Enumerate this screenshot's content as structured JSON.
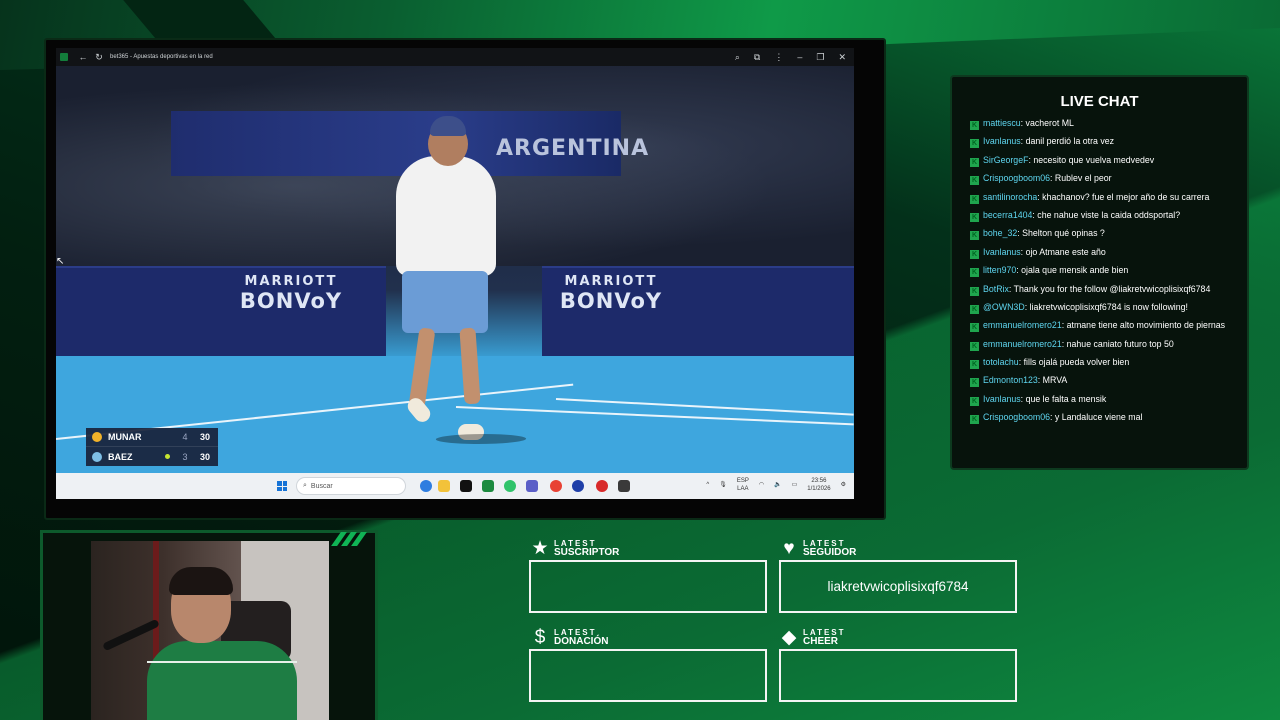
{
  "browser": {
    "title": "bet365 - Apuestas deportivas en la red",
    "taskbar": {
      "search_placeholder": "Buscar",
      "lang_top": "ESP",
      "lang_bottom": "LAA",
      "time": "23:56",
      "date": "1/1/2026"
    }
  },
  "video": {
    "banner_text": "ARGENTINA",
    "board_left_l1": "MARRIOTT",
    "board_left_l2": "BONVoY",
    "board_right_l1": "MARRIOTT",
    "board_right_l2": "BONVoY",
    "score": [
      {
        "name": "MUNAR",
        "sets": "4",
        "game": "30",
        "serving": false
      },
      {
        "name": "BAEZ",
        "sets": "3",
        "game": "30",
        "serving": true
      }
    ]
  },
  "chat": {
    "title": "LIVE CHAT",
    "messages": [
      {
        "user": "mattiescu",
        "text": "vacherot ML"
      },
      {
        "user": "Ivanlanus",
        "text": "danil perdió la otra vez"
      },
      {
        "user": "SirGeorgeF",
        "text": "necesito que vuelva medvedev"
      },
      {
        "user": "Crispoogboom06",
        "text": "Rublev el peor"
      },
      {
        "user": "santilinorocha",
        "text": "khachanov? fue el mejor año de su carrera"
      },
      {
        "user": "becerra1404",
        "text": "che nahue viste la caida oddsportal?"
      },
      {
        "user": "bohe_32",
        "text": "Shelton qué opinas ?"
      },
      {
        "user": "Ivanlanus",
        "text": "ojo Atmane este año"
      },
      {
        "user": "litten970",
        "text": "ojala que mensik ande bien"
      },
      {
        "user": "BotRix",
        "text": "Thank you for the follow @liakretvwicoplisixqf6784"
      },
      {
        "user": "@OWN3D",
        "text": "liakretvwicoplisixqf6784 is now following!"
      },
      {
        "user": "emmanuelromero21",
        "text": "atmane tiene alto movimiento de piernas"
      },
      {
        "user": "emmanuelromero21",
        "text": "nahue caniato futuro top 50"
      },
      {
        "user": "totolachu",
        "text": "fills ojalá pueda volver bien"
      },
      {
        "user": "Edmonton123",
        "text": "MRVA"
      },
      {
        "user": "Ivanlanus",
        "text": "que le falta a mensik"
      },
      {
        "user": "Crispoogboom06",
        "text": "y Landaluce viene mal"
      }
    ]
  },
  "latest": {
    "suscriptor": {
      "small": "LATEST",
      "big": "SUSCRIPTOR",
      "value": ""
    },
    "seguidor": {
      "small": "LATEST",
      "big": "SEGUIDOR",
      "value": "liakretvwicoplisixqf6784"
    },
    "donacion": {
      "small": "LATEST",
      "big": "DONACIÓN",
      "value": ""
    },
    "cheer": {
      "small": "LATEST",
      "big": "CHEER",
      "value": ""
    }
  },
  "colors": {
    "accent": "#10b455",
    "chat_user": "#5fd6f0",
    "badge": "#1fa54e"
  }
}
